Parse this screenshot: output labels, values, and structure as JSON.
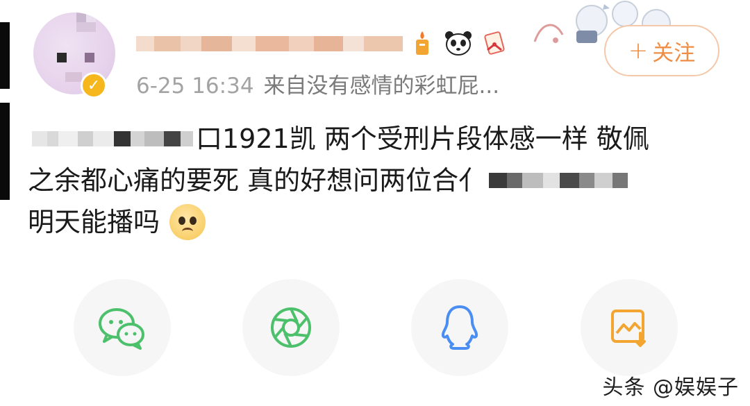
{
  "post": {
    "timestamp": "6-25 16:34",
    "source": "来自没有感情的彩虹屁...",
    "follow_label": "关注",
    "follow_plus": "+",
    "verified_glyph": "✓",
    "text_line1": "口1921凯 两个受刑片段体感一样 敬佩",
    "text_line2": "之余都心痛的要死 真的好想问两位合亻",
    "text_line3": "明天能播吗"
  },
  "icons": {
    "emoji_1": "candle-icon",
    "emoji_2": "panda-icon",
    "emoji_3": "scroll-gift-icon",
    "share": [
      "wechat-icon",
      "moments-icon",
      "qq-icon",
      "save-image-icon"
    ]
  },
  "colors": {
    "accent": "#f08d44",
    "share_green": "#4cc06b",
    "share_blue": "#4a8df3",
    "share_orange": "#f3a531"
  },
  "watermark": "头条 @娱娱子"
}
